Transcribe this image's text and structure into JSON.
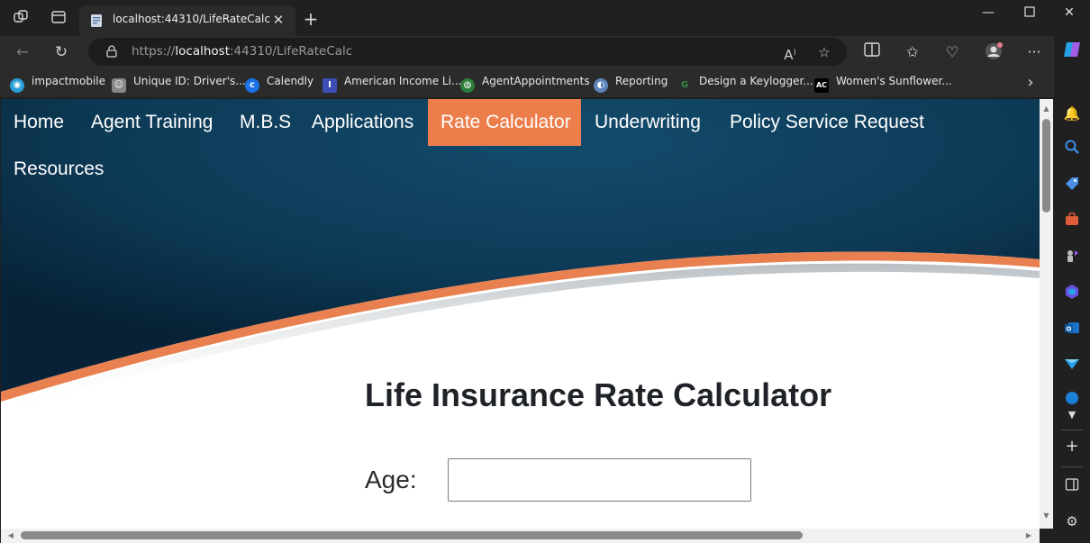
{
  "browser": {
    "tab": {
      "title": "localhost:44310/LifeRateCalc"
    },
    "address": {
      "scheme": "https://",
      "host": "localhost",
      "rest": ":44310/LifeRateCalc"
    },
    "favorites": [
      {
        "label": "impactmobile",
        "icon": "impactmobile-icon",
        "color": "#2a9fd6"
      },
      {
        "label": "Unique ID: Driver's...",
        "icon": "avatar-icon",
        "color": "#888888"
      },
      {
        "label": "Calendly",
        "icon": "calendly-icon",
        "color": "#1a73e8"
      },
      {
        "label": "American Income Li...",
        "icon": "ail-icon",
        "color": "#3d4fb5",
        "glyph": "I"
      },
      {
        "label": "AgentAppointments",
        "icon": "globe-icon",
        "color": "#2f7d3b"
      },
      {
        "label": "Reporting",
        "icon": "reporting-icon",
        "color": "#5d84b8"
      },
      {
        "label": "Design a Keylogger...",
        "icon": "gfg-icon",
        "color": "#2f8d46",
        "glyph": "G"
      },
      {
        "label": "Women's Sunflower...",
        "icon": "ac-icon",
        "color": "#000000",
        "glyph": "AC"
      }
    ]
  },
  "site": {
    "nav": [
      {
        "label": "Home",
        "active": false
      },
      {
        "label": "Agent Training",
        "active": false
      },
      {
        "label": "M.B.S",
        "active": false
      },
      {
        "label": "Applications",
        "active": false
      },
      {
        "label": "Rate Calculator",
        "active": true
      },
      {
        "label": "Underwriting",
        "active": false
      },
      {
        "label": "Policy Service Request",
        "active": false
      },
      {
        "label": "Resources",
        "active": false
      }
    ],
    "colors": {
      "accent": "#ec7e4c",
      "hero_dark": "#0c2c44",
      "hero_light": "#124a6a"
    }
  },
  "page": {
    "title": "Life Insurance Rate Calculator",
    "age_label": "Age:",
    "age_value": ""
  }
}
